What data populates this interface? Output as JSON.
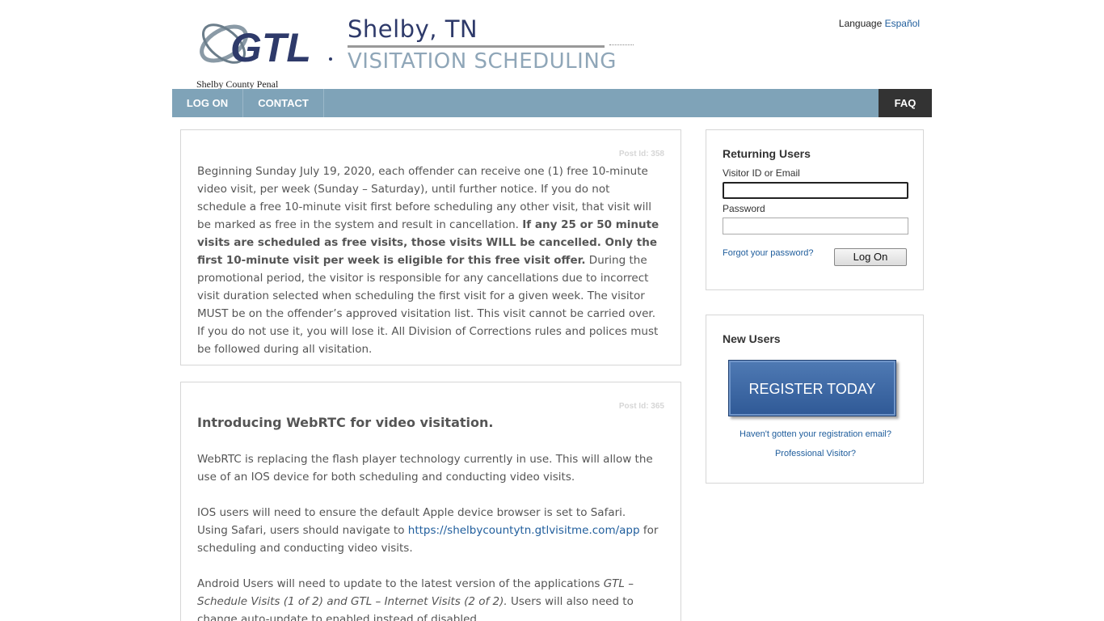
{
  "header": {
    "logo_text": "GTL",
    "title_city": "Shelby, TN",
    "title_sub": "VISITATION SCHEDULING",
    "facility": "Shelby County Penal",
    "language_label": "Language",
    "language_link": "Español"
  },
  "nav": {
    "logon": "LOG ON",
    "contact": "CONTACT",
    "faq": "FAQ"
  },
  "posts": [
    {
      "post_id": "Post Id: 358",
      "part1": "Beginning Sunday July 19, 2020, each offender can receive one (1) free 10-minute video visit, per week (Sunday – Saturday), until further notice. If you do not schedule a free 10-minute visit first before scheduling any other visit, that visit will be marked as free in the system and result in cancellation. ",
      "bold": "If any 25 or 50 minute visits are scheduled as free visits, those visits WILL be cancelled. Only the first 10-minute visit per week is eligible for this free visit offer.",
      "part2": " During the promotional period, the visitor is responsible for any cancellations due to incorrect visit duration selected when scheduling the first visit for a given week. The visitor MUST be on the offender’s approved visitation list. This visit cannot be carried over.  If you do not use it, you will lose it.  All Division of Corrections rules and polices must be followed during all visitation."
    },
    {
      "post_id": "Post Id: 365",
      "heading": "Introducing WebRTC for video visitation.",
      "p1": "WebRTC is replacing the flash player technology currently in use. This will allow the use of an IOS device for both scheduling and conducting video visits.",
      "p2_before": "IOS users will need to ensure the default Apple device browser is set to Safari. Using Safari, users should navigate to ",
      "p2_link": "https://shelbycountytn.gtlvisitme.com/app",
      "p2_after": " for scheduling and conducting video visits.",
      "p3_before": "Android Users will need to update to the latest version of the applications ",
      "p3_italic": "GTL – Schedule Visits (1 of 2) and GTL – Internet Visits (2 of 2).",
      "p3_after": " Users will also need to change auto-update to enabled instead of disabled."
    }
  ],
  "login": {
    "title": "Returning Users",
    "visitor_label": "Visitor ID or Email",
    "visitor_value": "",
    "password_label": "Password",
    "password_value": "",
    "forgot": "Forgot your password?",
    "button": "Log On"
  },
  "new_users": {
    "title": "New Users",
    "register": "REGISTER TODAY",
    "no_email": "Haven't gotten your registration email?",
    "professional": "Professional Visitor?"
  },
  "colors": {
    "nav_bg": "#7fa3b8",
    "faq_bg": "#333333",
    "link": "#1f5d9c",
    "register_bg": "#3f6aa6"
  }
}
